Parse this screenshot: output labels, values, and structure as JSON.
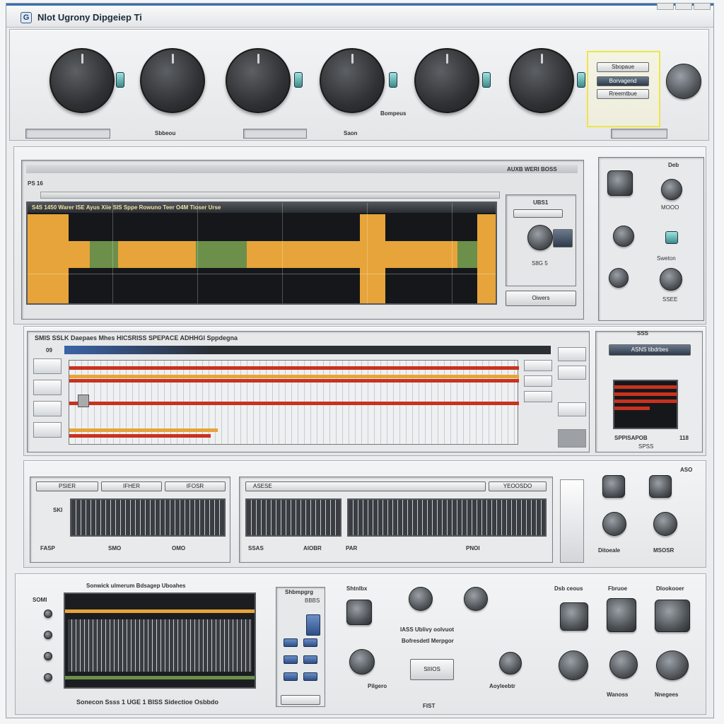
{
  "window": {
    "app_icon": "G",
    "title": "Nlot Ugrony Dipgeiep Ti"
  },
  "top_rack": {
    "knob_labels": [
      "",
      "Sbbeou",
      "",
      "Saon",
      "Bompeus",
      ""
    ],
    "small_labels": [
      "",
      "",
      "",
      "",
      "",
      ""
    ],
    "preset": {
      "line1": "Sbopaue",
      "line2": "Borvagend",
      "line3": "Rreemtbue"
    }
  },
  "editor": {
    "toolbar_text": "AUXB  WERI BOSS",
    "track_label": "PS 16",
    "header_strip": "S4S  1450 Warer   ISE  Ayus  Xiie  SIS  Sppe  Rowuno  Teer  O4M  Tioser Urse",
    "side": {
      "title": "UBS1",
      "value": "S8G 5",
      "button": "Oiwers"
    },
    "right_controls": [
      "Deb",
      "MOOO",
      "Sweton",
      "SSEE"
    ]
  },
  "sequencer": {
    "header": "SMIS SSLK Daepaes Mhes HICSRISS SPEPACE ADHHGI Sppdegna",
    "counter": "09",
    "lcd_title": "ASNS tibdrbes",
    "lcd_caption": "SPPISAPOB",
    "lcd_value": "SPSS",
    "lcd_num": "118",
    "right_label": "SSS"
  },
  "mixer": {
    "left_tabs": [
      "PSIER",
      "IFHER",
      "IFOSR"
    ],
    "right_tabs": [
      "ASESE",
      "YEOOSDO"
    ],
    "left_label": "SKI",
    "footer_left": [
      "FASP",
      "SMO",
      "OMO"
    ],
    "footer_right": [
      "SSAS",
      "AIOBR",
      "PAR",
      "PNOI"
    ],
    "knob_labels": [
      "Ditoeale",
      "MSOSR"
    ],
    "top_label": "ASO"
  },
  "bottom": {
    "title": "SOMI",
    "header": "Sonwick ulmerum   Bdsagep Uboahes",
    "caption": "Sonecon Ssss 1 UGE 1 BISS  Sidectioe Osbbdo",
    "mid_title": "Shbmpgrg",
    "mid_sub": "BBBS",
    "center_labels": [
      "Shtnlbx",
      "IASS Ublivy oolvuot",
      "Bofresdetl Merpgor"
    ],
    "center_btn": "SIIIOS",
    "center_foot": "FIST",
    "right_groups": [
      "Dsb ceous",
      "Fbruoe",
      "Dlookooer"
    ],
    "right_foot": [
      "Pilgero",
      "Aoyleebtr",
      "Wanoss",
      "Nnegees"
    ]
  },
  "colors": {
    "accent": "#3b6fb0",
    "track_orange": "#e6a43a",
    "track_green": "#6c8f4a",
    "seq_red": "#c8321f",
    "highlight_yellow": "#f0e44a"
  }
}
